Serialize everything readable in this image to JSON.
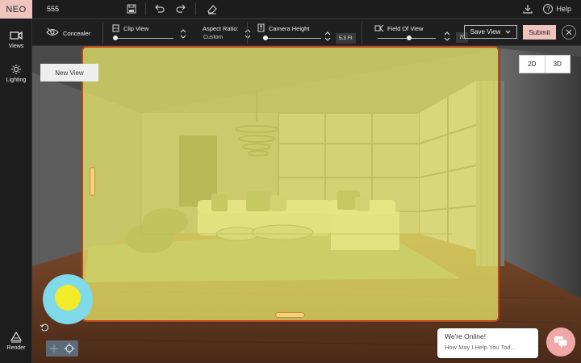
{
  "app": {
    "logo": "NEO",
    "project_name": "555",
    "help_label": "Help"
  },
  "sidebar": {
    "items": [
      {
        "label": "Views",
        "icon": "camera-icon"
      },
      {
        "label": "Lighting",
        "icon": "sun-icon"
      },
      {
        "label": "Render",
        "icon": "render-icon"
      }
    ]
  },
  "toolbar": {
    "concealer_label": "Concealer",
    "clip_view_label": "Clip View",
    "aspect_ratio_label": "Aspect Ratio:",
    "aspect_ratio_value": "Custom",
    "camera_height_label": "Camera Height",
    "camera_height_value": "5.3 Ft",
    "field_of_view_label": "Field Of View",
    "field_of_view_value": "70",
    "save_view_label": "Save View",
    "submit_label": "Submit"
  },
  "viewport": {
    "new_view_label": "New View",
    "mode_2d": "2D",
    "mode_3d": "3D"
  },
  "chat": {
    "title": "We're Online!",
    "subtitle": "How May I Help You Tod..."
  },
  "colors": {
    "accent": "#f0c4be",
    "frame_border": "#b8451f",
    "frame_fill": "#f0ee6e",
    "joystick_outer": "#7ed9e8",
    "joystick_inner": "#f3ea2a"
  }
}
